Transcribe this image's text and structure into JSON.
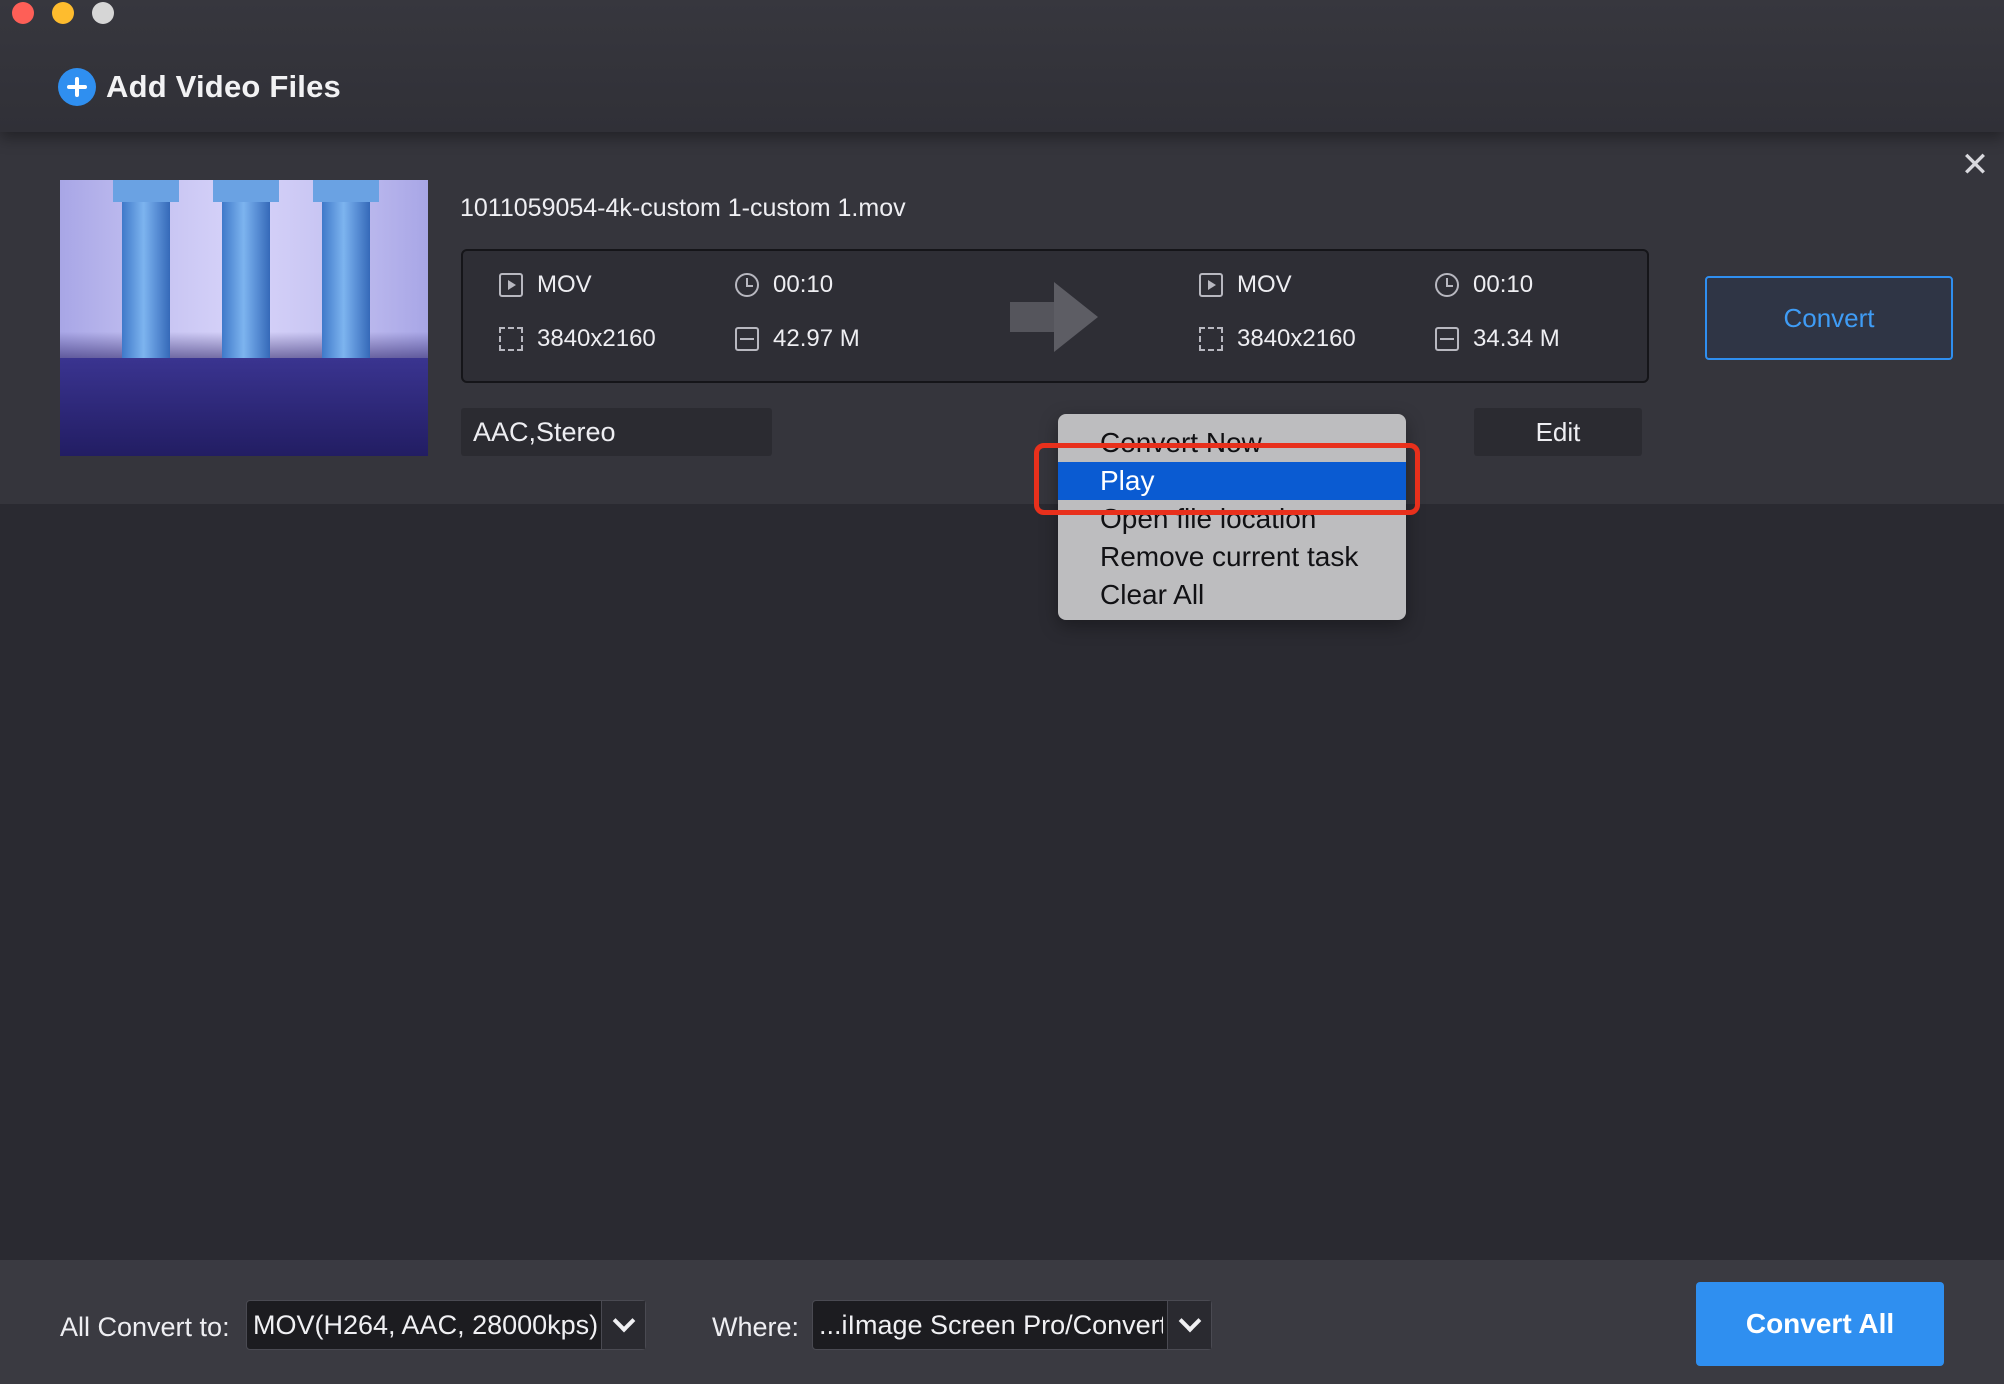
{
  "header": {
    "add_files_label": "Add Video Files"
  },
  "task": {
    "filename": "1011059054-4k-custom 1-custom 1.mov",
    "source": {
      "format": "MOV",
      "duration": "00:10",
      "resolution": "3840x2160",
      "size": "42.97 M"
    },
    "output": {
      "format": "MOV",
      "duration": "00:10",
      "resolution": "3840x2160",
      "size": "34.34 M"
    },
    "audio": "AAC,Stereo",
    "edit_label": "Edit",
    "convert_label": "Convert",
    "close_glyph": "✕"
  },
  "context_menu": {
    "items": [
      {
        "label": "Convert Now"
      },
      {
        "label": "Play",
        "highlighted": true
      },
      {
        "label": "Open file location"
      },
      {
        "label": "Remove current task"
      },
      {
        "label": "Clear All"
      }
    ]
  },
  "bottom": {
    "convert_to_label": "All Convert to:",
    "convert_to_value": "MOV(H264, AAC, 28000kps)",
    "where_label": "Where:",
    "where_value": "...iImage Screen Pro/Convert",
    "convert_all_label": "Convert All"
  },
  "colors": {
    "accent": "#2f8ff0",
    "menu_highlight": "#0a5bd2",
    "annotation_red": "#e8301c"
  }
}
